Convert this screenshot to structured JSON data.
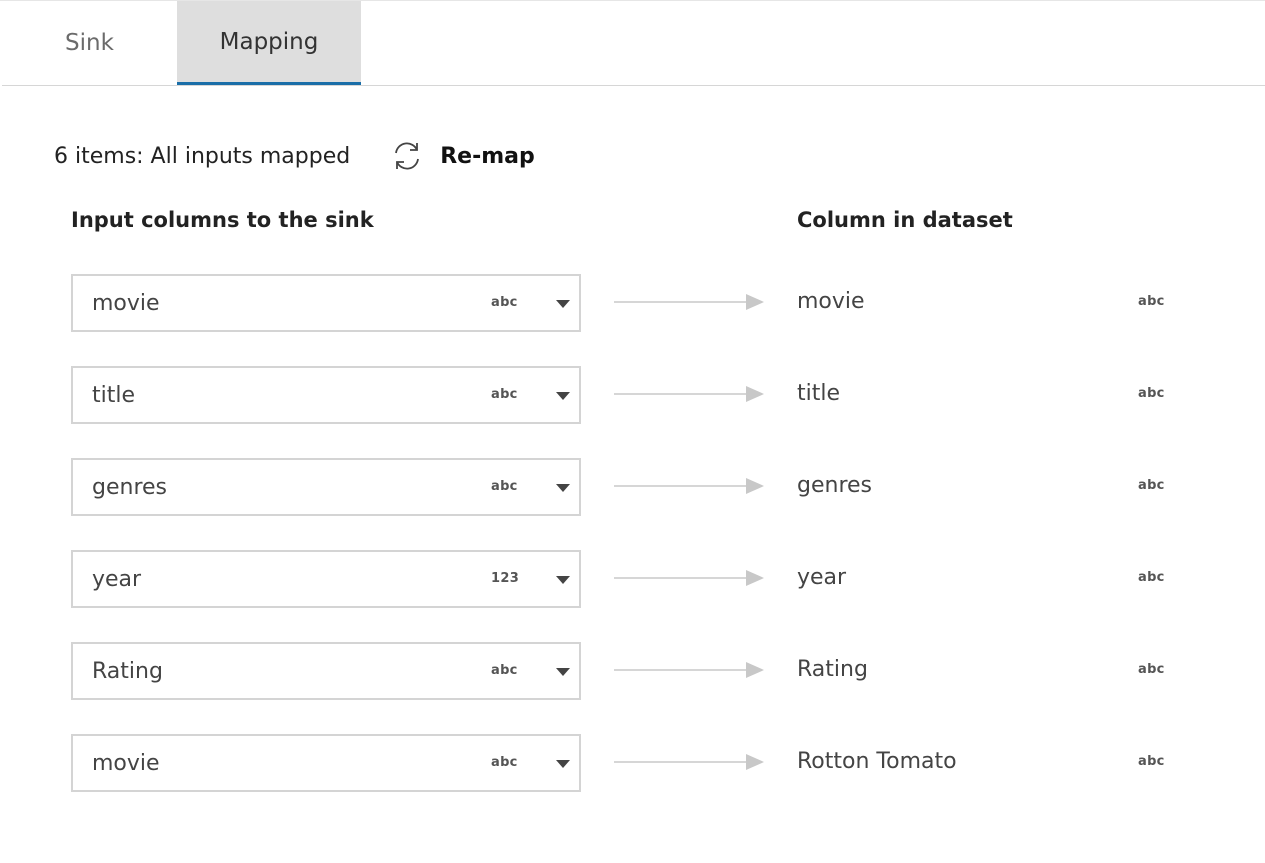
{
  "tabs": {
    "sink_label": "Sink",
    "mapping_label": "Mapping",
    "active": "Mapping"
  },
  "status": {
    "text": "6 items: All inputs mapped",
    "remap_label": "Re-map"
  },
  "headers": {
    "input": "Input columns to the sink",
    "output": "Column in dataset"
  },
  "rows": [
    {
      "input": "movie",
      "input_type": "abc",
      "output": "movie",
      "output_type": "abc"
    },
    {
      "input": "title",
      "input_type": "abc",
      "output": "title",
      "output_type": "abc"
    },
    {
      "input": "genres",
      "input_type": "abc",
      "output": "genres",
      "output_type": "abc"
    },
    {
      "input": "year",
      "input_type": "123",
      "output": "year",
      "output_type": "abc"
    },
    {
      "input": "Rating",
      "input_type": "abc",
      "output": "Rating",
      "output_type": "abc"
    },
    {
      "input": "movie",
      "input_type": "abc",
      "output": "Rotton Tomato",
      "output_type": "abc"
    }
  ],
  "icons": {
    "remap": "refresh-icon",
    "dropdown": "chevron-down-icon",
    "mapping": "arrow-right-icon"
  },
  "colors": {
    "active_tab_bg": "#dedede",
    "active_tab_underline": "#1a6ea8",
    "field_border": "#d4d4d4",
    "arrow": "#c8c8c8"
  }
}
